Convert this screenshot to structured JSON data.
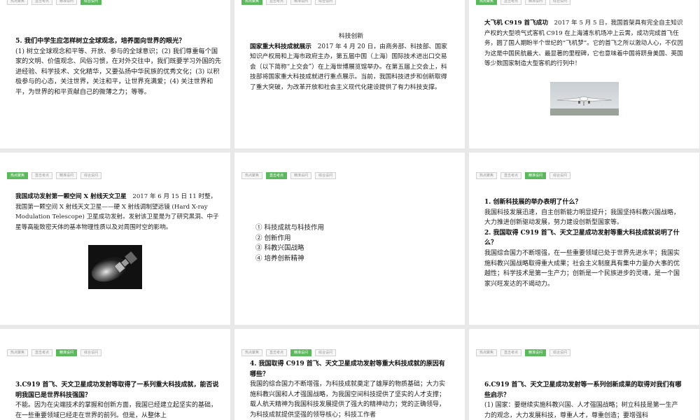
{
  "tabs": [
    "热点聚焦",
    "直击考点",
    "精准设问",
    "综合设问"
  ],
  "slide1": {
    "active_tab": 3,
    "question": "5. 我们中学生应怎样树立全球观念，培养面向世界的眼光？",
    "answer": "(1) 树立全球观念和平等、开放、参与的全球意识；(2) 我们尊重每个国家的文明、价值观念、风俗习惯，在对外交往中，我们既要学习外国的先进经验、科学技术、文化精华，又要弘扬中华民族的优秀文化；(3) 以积极参与的心态，关注世界，关注和平，让世界充满爱；(4) 关注世界和平，为世界的和平贡献自己的微薄之力；等等。"
  },
  "slide2": {
    "active_tab": 0,
    "heading": "科技创新",
    "lead": "国家重大科技成就展示",
    "body": "2017 年 4 月 20 日，由商务部、科技部、国家知识产权局和上海市政府主办，第五届中国（上海）国际技术进出口交易会（以下简称“上交会”）在上海世博展览馆举办。在第五届上交会上，科技部将国家重大科技成就进行重点展示。当前，我国科技进步和创新取得了重大突破，为改革开放和社会主义现代化建设提供了有力科技支撑。"
  },
  "slide3": {
    "active_tab": 0,
    "lead": "大飞机 C919 首飞成功",
    "body": "2017 年 5 月 5 日，我国首架具有完全自主知识产权的大型喷气式客机 C919 在上海浦东机场冲上云霄，成功完成首飞任务，圆了国人期盼半个世纪的“飞机梦”。它的首飞之所以激动人心，不仅因为这是中国民航最大、最显著的里程碑，它也意味着中国将跻身美国、英国等少数国家制造大型客机的行列中！",
    "image_icon": "airplane-photo"
  },
  "slide4": {
    "active_tab": 0,
    "lead": "我国成功发射第一颗空间 X 射线天文卫星",
    "body": "2017 年 6 月 15 日 11 时整，我国第一颗空间 X 射线天文卫星——硬 X 射线调制望远镜 (Hard X-ray Modulation Telescope) 卫星成功发射。发射该卫星是为了研究黑洞、中子星等高能致密天体的基本物理性质以及对周围时空的影响。",
    "image_icon": "satellite-photo"
  },
  "slide5": {
    "active_tab": 1,
    "items": [
      "① 科技成就与科技作用",
      "② 创新作用",
      "③ 科教兴国战略",
      "④ 培养创新精神"
    ]
  },
  "slide6": {
    "active_tab": 2,
    "q1": "1. 创新科技展的举办表明了什么？",
    "a1": "我国科技发展迅速，自主创新能力明显提升；我国坚持科教兴国战略，大力推进创新驱动发展，努力建设创新型国家等。",
    "q2": "2. 我国取得 C919 首飞、天文卫星成功发射等重大科技成就说明了什么？",
    "a2": "我国综合国力不断增强，在一些重要领域已处于世界先进水平；我国实施科教兴国战略取得重大成果；社会主义制度具有集中力量办大事的优越性；科学技术是第一生产力；创新是一个民族进步的灵魂，是一个国家兴旺发达的不竭动力。"
  },
  "slide7": {
    "active_tab": 2,
    "question": "3.C919 首飞、天文卫星成功发射等取得了一系列重大科技成就，能否说明我国已是世界科技强国？",
    "answer": "不能。因为在尖端技术的掌握和创新方面，我国已经建立起坚实的基础，在一些重要领域已经走在世界的前列。但是，从整体上"
  },
  "slide8": {
    "active_tab": 2,
    "question": "4. 我国取得 C919 首飞、天文卫星成功发射等重大科技成就的原因有哪些？",
    "answer": "我国的综合国力不断增强，为科技成就奠定了雄厚的物质基础；大力实施科教兴国和人才强国战略，为我国空间科技提供了坚实的人才支撑；载人航天精神为我国科技发展提供了强大的精神动力；党的正确领导，为科技成就提供坚强的领导核心；科技工作者"
  },
  "slide9": {
    "active_tab": 2,
    "question": "6.C919 首飞、天文卫星成功发射等一系列创新成果的取得对我们有哪些启示？",
    "answer": "(1) 国家：要继续实施科教兴国、人才强国战略；树立科技是第一生产力的观念，大力发展科技，尊重人才，尊重创造；要增强科"
  }
}
